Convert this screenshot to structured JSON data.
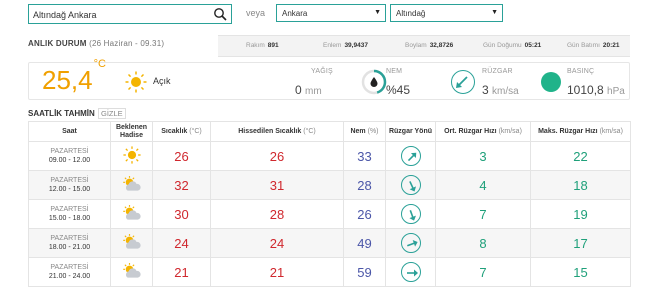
{
  "search": {
    "value": "Altındağ Ankara"
  },
  "veya": "veya",
  "selects": {
    "province": "Ankara",
    "district": "Altındağ"
  },
  "current": {
    "title": "ANLIK DURUM",
    "datetime": "(26 Haziran - 09.31)",
    "stats": [
      {
        "label": "Rakım",
        "value": "891"
      },
      {
        "label": "Enlem",
        "value": "39,9437"
      },
      {
        "label": "Boylam",
        "value": "32,8726"
      },
      {
        "label": "Gün Doğumu",
        "value": "05:21"
      },
      {
        "label": "Gün Batımı",
        "value": "20:21"
      }
    ],
    "temperature": "25,4",
    "temp_unit": "°C",
    "condition": "Açık",
    "rain_label": "YAĞIŞ",
    "rain_value": "0",
    "rain_unit": "mm",
    "humidity_label": "NEM",
    "humidity_value": "%45",
    "humidity_fraction": 0.45,
    "wind_label": "RÜZGAR",
    "wind_value": "3",
    "wind_unit": "km/sa",
    "pressure_label": "BASINÇ",
    "pressure_value": "1010,8",
    "pressure_unit": "hPa"
  },
  "hourly": {
    "title": "SAATLİK TAHMİN",
    "hide_label": "GİZLE",
    "headers": {
      "saat": "Saat",
      "hadise1": "Beklenen",
      "hadise2": "Hadise",
      "sicaklik": "Sıcaklık",
      "sicaklik_unit": "(°C)",
      "hissedilen": "Hissedilen Sıcaklık",
      "hissedilen_unit": "(°C)",
      "nem": "Nem",
      "nem_unit": "(%)",
      "yon": "Rüzgar Yönü",
      "ort": "Ort. Rüzgar Hızı",
      "ort_unit": "(km/sa)",
      "maks": "Maks. Rüzgar Hızı",
      "maks_unit": "(km/sa)"
    },
    "rows": [
      {
        "day": "PAZARTESİ",
        "time": "09.00 - 12.00",
        "icon": "sun-icon",
        "temp": "26",
        "feels": "26",
        "humidity": "33",
        "wind_dir_deg": 225,
        "avg": "3",
        "max": "22"
      },
      {
        "day": "PAZARTESİ",
        "time": "12.00 - 15.00",
        "icon": "partly-cloudy-icon",
        "temp": "32",
        "feels": "31",
        "humidity": "28",
        "wind_dir_deg": 335,
        "avg": "4",
        "max": "18"
      },
      {
        "day": "PAZARTESİ",
        "time": "15.00 - 18.00",
        "icon": "partly-cloudy-icon",
        "temp": "30",
        "feels": "28",
        "humidity": "26",
        "wind_dir_deg": 340,
        "avg": "7",
        "max": "19"
      },
      {
        "day": "PAZARTESİ",
        "time": "18.00 - 21.00",
        "icon": "partly-cloudy-icon",
        "temp": "24",
        "feels": "24",
        "humidity": "49",
        "wind_dir_deg": 250,
        "avg": "8",
        "max": "17"
      },
      {
        "day": "PAZARTESİ",
        "time": "21.00 - 24.00",
        "icon": "partly-cloudy-icon",
        "temp": "21",
        "feels": "21",
        "humidity": "59",
        "wind_dir_deg": 270,
        "avg": "7",
        "max": "15"
      }
    ]
  },
  "colors": {
    "accent": "#2aa198",
    "temp": "#f0a000",
    "red": "#d0282e",
    "blue": "#4b56a8",
    "green": "#1fa07a"
  }
}
